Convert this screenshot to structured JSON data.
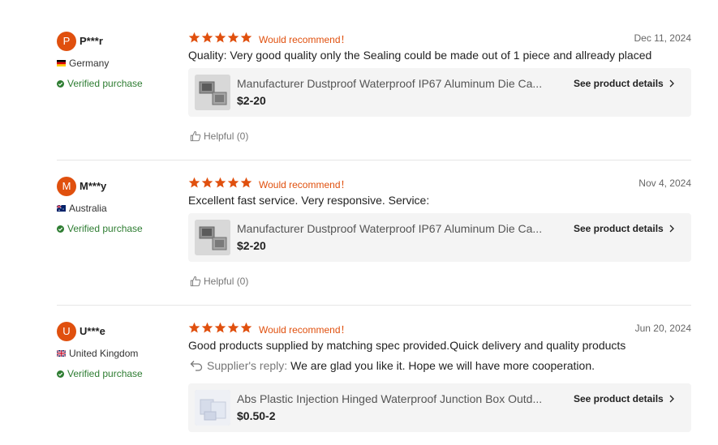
{
  "reviews": [
    {
      "avatar_letter": "P",
      "username": "P***r",
      "country": "Germany",
      "verified": "Verified purchase",
      "rating": 5,
      "recommend": "Would recommend！",
      "date": "Dec 11, 2024",
      "text": "Quality: Very good quality only the Sealing could be made out of 1 piece and allready placed",
      "product": {
        "name": "Manufacturer Dustproof Waterproof IP67 Aluminum Die Ca...",
        "price": "$2-20",
        "details": "See product details"
      },
      "helpful": "Helpful (0)"
    },
    {
      "avatar_letter": "M",
      "username": "M***y",
      "country": "Australia",
      "verified": "Verified purchase",
      "rating": 5,
      "recommend": "Would recommend！",
      "date": "Nov 4, 2024",
      "text": "Excellent fast service.  Very responsive. Service:",
      "product": {
        "name": "Manufacturer Dustproof Waterproof IP67 Aluminum Die Ca...",
        "price": "$2-20",
        "details": "See product details"
      },
      "helpful": "Helpful (0)"
    },
    {
      "avatar_letter": "U",
      "username": "U***e",
      "country": "United Kingdom",
      "verified": "Verified purchase",
      "rating": 5,
      "recommend": "Would recommend！",
      "date": "Jun 20, 2024",
      "text": "Good products supplied by matching spec provided.Quick delivery and quality products",
      "reply_label": "Supplier's reply:",
      "reply_text": "We are glad you like it. Hope we will have more cooperation.",
      "product": {
        "name": "Abs Plastic Injection Hinged Waterproof Junction Box Outd...",
        "price": "$0.50-2",
        "details": "See product details"
      }
    }
  ],
  "colors": {
    "accent": "#e0500e",
    "verified": "#2e7d32",
    "card_bg": "#f4f4f4"
  },
  "icons": [
    "star-icon",
    "check-circle-icon",
    "thumbs-up-icon",
    "reply-arrow-icon",
    "chevron-right-icon"
  ]
}
